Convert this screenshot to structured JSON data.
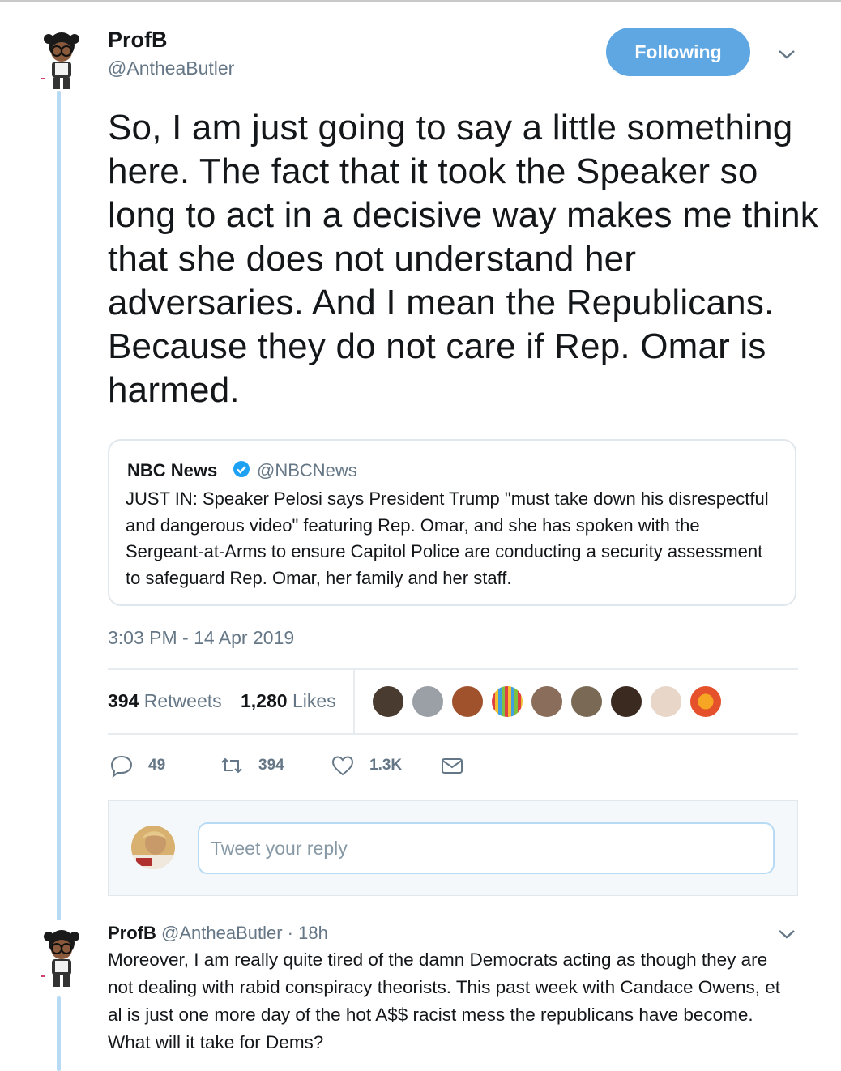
{
  "tweet": {
    "author_name": "ProfB",
    "author_handle": "@AntheaButler",
    "follow_label": "Following",
    "text": "So, I am just going to say a little something here. The fact that it took the Speaker so long to act in a decisive way makes me think that she does not understand her adversaries. And I mean the Republicans. Because they do not care if Rep. Omar is harmed.",
    "timestamp": "3:03 PM - 14 Apr 2019"
  },
  "quoted_tweet": {
    "author_name": "NBC News",
    "author_handle": "@NBCNews",
    "verified": true,
    "text": "JUST IN: Speaker Pelosi says President Trump \"must take down his disrespectful and dangerous video\" featuring Rep. Omar, and she has spoken with the Sergeant-at-Arms to ensure Capitol Police are conducting a security assessment to safeguard Rep. Omar, her family and her staff."
  },
  "stats": {
    "retweets_count": "394",
    "retweets_label": "Retweets",
    "likes_count": "1,280",
    "likes_label": "Likes"
  },
  "likers": [
    {
      "icon": "liker-avatar-1",
      "color": "#4a3b30"
    },
    {
      "icon": "liker-avatar-2",
      "color": "#9aa0a6"
    },
    {
      "icon": "liker-avatar-3",
      "color": "#a0522d"
    },
    {
      "icon": "liker-avatar-4",
      "color": "#7fb069"
    },
    {
      "icon": "liker-avatar-5",
      "color": "#8a6d5a"
    },
    {
      "icon": "liker-avatar-6",
      "color": "#7a6a55"
    },
    {
      "icon": "liker-avatar-7",
      "color": "#3b2a20"
    },
    {
      "icon": "liker-avatar-8",
      "color": "#e8d6c8"
    },
    {
      "icon": "liker-avatar-9",
      "color": "#e5512b"
    }
  ],
  "actions": {
    "reply_count": "49",
    "retweet_count": "394",
    "like_count": "1.3K"
  },
  "reply_composer": {
    "placeholder": "Tweet your reply"
  },
  "reply_tweet": {
    "author_name": "ProfB",
    "author_handle": "@AntheaButler",
    "separator": "·",
    "time": "18h",
    "text": "Moreover, I am really quite tired of the damn Democrats acting as though they are not dealing with rabid conspiracy theorists. This past week with Candace Owens, et al is just one more day of the hot A$$ racist mess the republicans have become. What will it take for Dems?"
  },
  "colors": {
    "accent": "#1da1f2",
    "follow_button": "#5fa7e3",
    "thread_line": "#b7dbf5",
    "muted_text": "#657786"
  }
}
